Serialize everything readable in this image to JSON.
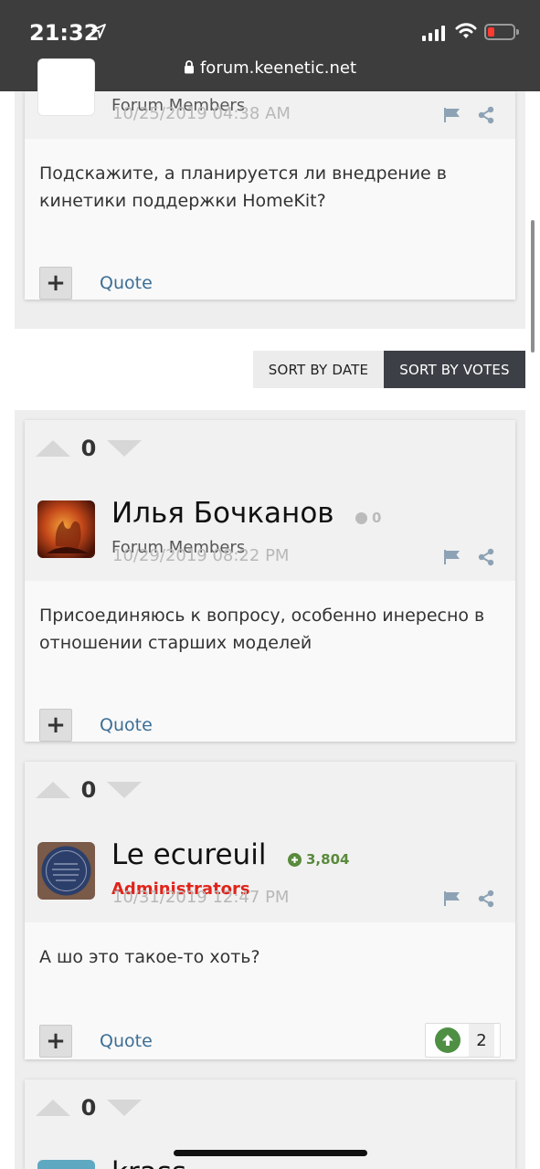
{
  "status_bar": {
    "time": "21:32",
    "url": "forum.keenetic.net",
    "battery_color": "#ff3b30"
  },
  "sort": {
    "by_date": "SORT BY DATE",
    "by_votes": "SORT BY VOTES",
    "active": "by_votes"
  },
  "posts": [
    {
      "role": "Forum Members",
      "date": "10/25/2019 04:38 AM",
      "body_lines": [
        "Подскажите, а планируется ли внедрение в",
        "кинетики поддержки HomeKit?"
      ],
      "quote_label": "Quote",
      "plus_label": "+"
    },
    {
      "votes": "0",
      "author": "Илья Бочканов",
      "reputation": "0",
      "role": "Forum Members",
      "date": "10/29/2019 08:22 PM",
      "body_lines": [
        "Присоединяюсь к вопросу, особенно инересно в",
        "отношении старших моделей"
      ],
      "quote_label": "Quote",
      "plus_label": "+"
    },
    {
      "votes": "0",
      "author": "Le ecureuil",
      "reputation": "3,804",
      "role": "Administrators",
      "date": "10/31/2019 12:47 PM",
      "body_lines": [
        "А шо это такое-то хоть?"
      ],
      "quote_label": "Quote",
      "plus_label": "+",
      "likes": "2"
    },
    {
      "votes": "0",
      "author": "krass"
    }
  ],
  "icons": {
    "location": "location-arrow-icon",
    "lock": "lock-icon",
    "flag": "flag-icon",
    "share": "share-icon",
    "upvote": "arrow-up-icon"
  },
  "colors": {
    "admin_role": "#e0241b",
    "reputation_positive": "#5a8a3c",
    "like_badge": "#4e8f44",
    "quote_link": "#3d6e94",
    "sort_active_bg": "#3c3f45"
  }
}
